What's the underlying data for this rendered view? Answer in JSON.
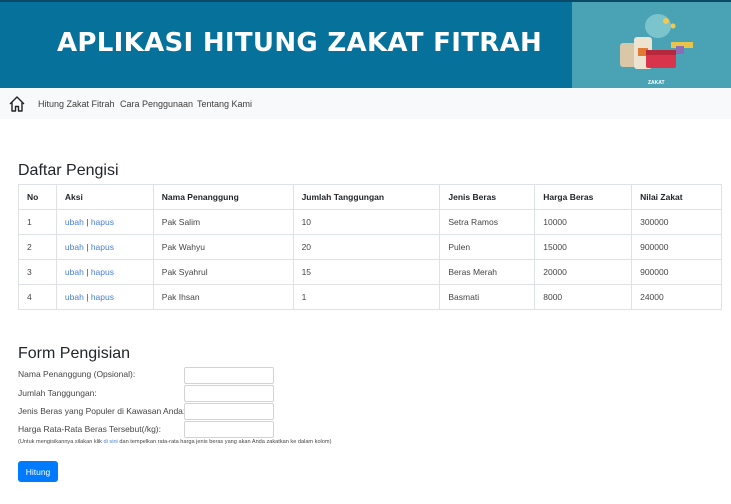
{
  "banner": {
    "title": "APLIKASI HITUNG ZAKAT FITRAH",
    "image_label": "ZAKAT"
  },
  "nav": {
    "home_icon": "home-icon",
    "links": [
      "Hitung Zakat Fitrah",
      "Cara Penggunaan",
      "Tentang Kami"
    ]
  },
  "list": {
    "title": "Daftar Pengisi",
    "columns": [
      "No",
      "Aksi",
      "Nama Penanggung",
      "Jumlah Tanggungan",
      "Jenis Beras",
      "Harga Beras",
      "Nilai Zakat"
    ],
    "edit_label": "ubah",
    "separator": "|",
    "delete_label": "hapus",
    "rows": [
      {
        "no": "1",
        "nama": "Pak Salim",
        "jumlah": "10",
        "jenis": "Setra Ramos",
        "harga": "10000",
        "nilai": "300000"
      },
      {
        "no": "2",
        "nama": "Pak Wahyu",
        "jumlah": "20",
        "jenis": "Pulen",
        "harga": "15000",
        "nilai": "900000"
      },
      {
        "no": "3",
        "nama": "Pak Syahrul",
        "jumlah": "15",
        "jenis": "Beras Merah",
        "harga": "20000",
        "nilai": "900000"
      },
      {
        "no": "4",
        "nama": "Pak Ihsan",
        "jumlah": "1",
        "jenis": "Basmati",
        "harga": "8000",
        "nilai": "24000"
      }
    ]
  },
  "form": {
    "title": "Form Pengisian",
    "fields": [
      {
        "label": "Nama Penanggung (Opsional):",
        "value": ""
      },
      {
        "label": "Jumlah Tanggungan:",
        "value": ""
      },
      {
        "label": "Jenis Beras yang Populer di Kawasan Anda:",
        "value": ""
      },
      {
        "label": "Harga Rata-Rata Beras Tersebut(/kg):",
        "value": ""
      }
    ],
    "note_before": "(Untuk mengisikannya silakan klik ",
    "note_link": "di sini",
    "note_after": " dan tempelkan rata-rata harga jenis beras yang akan Anda zakatkan ke dalam kolom)",
    "submit_label": "Hitung"
  },
  "colors": {
    "banner": "#06729c",
    "primary_button": "#007bff",
    "link": "#4a7fd4"
  }
}
